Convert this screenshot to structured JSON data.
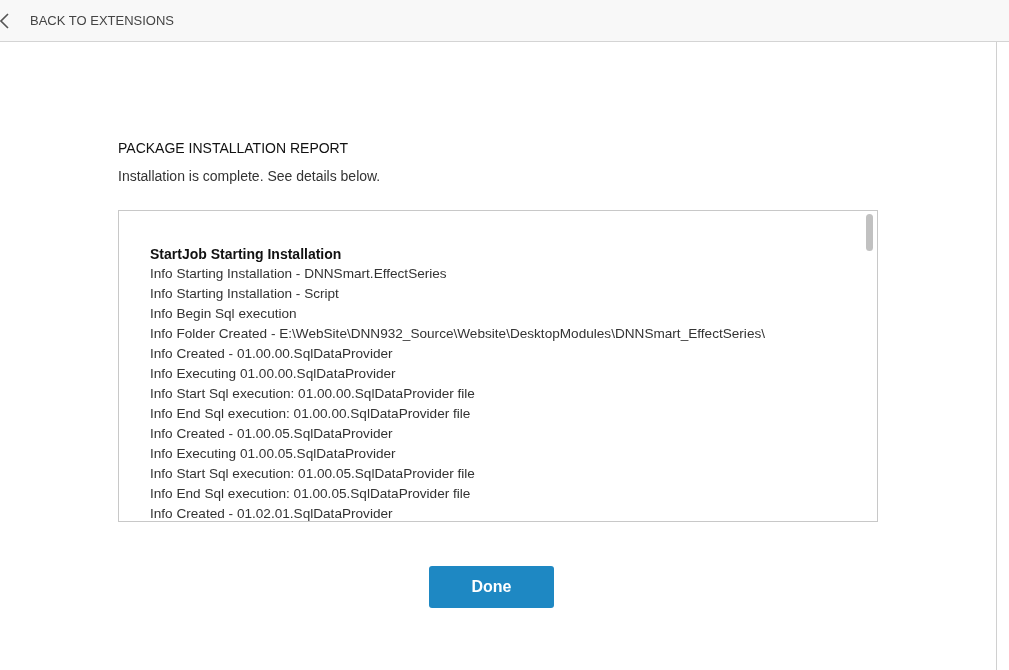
{
  "header": {
    "back_link": "BACK TO EXTENSIONS"
  },
  "report": {
    "title": "PACKAGE INSTALLATION REPORT",
    "message": "Installation is complete. See details below.",
    "log": [
      {
        "kind": "heading",
        "text": "StartJob Starting Installation"
      },
      {
        "kind": "info",
        "text": "Info Starting Installation - DNNSmart.EffectSeries"
      },
      {
        "kind": "info",
        "text": "Info Starting Installation - Script"
      },
      {
        "kind": "info",
        "text": "Info Begin Sql execution"
      },
      {
        "kind": "info",
        "text": "Info Folder Created - E:\\WebSite\\DNN932_Source\\Website\\DesktopModules\\DNNSmart_EffectSeries\\"
      },
      {
        "kind": "info",
        "text": "Info Created - 01.00.00.SqlDataProvider"
      },
      {
        "kind": "info",
        "text": "Info Executing 01.00.00.SqlDataProvider"
      },
      {
        "kind": "info",
        "text": "Info Start Sql execution: 01.00.00.SqlDataProvider file"
      },
      {
        "kind": "info",
        "text": "Info End Sql execution: 01.00.00.SqlDataProvider file"
      },
      {
        "kind": "info",
        "text": "Info Created - 01.00.05.SqlDataProvider"
      },
      {
        "kind": "info",
        "text": "Info Executing 01.00.05.SqlDataProvider"
      },
      {
        "kind": "info",
        "text": "Info Start Sql execution: 01.00.05.SqlDataProvider file"
      },
      {
        "kind": "info",
        "text": "Info End Sql execution: 01.00.05.SqlDataProvider file"
      },
      {
        "kind": "info",
        "text": "Info Created - 01.02.01.SqlDataProvider"
      }
    ],
    "done_button": "Done"
  }
}
